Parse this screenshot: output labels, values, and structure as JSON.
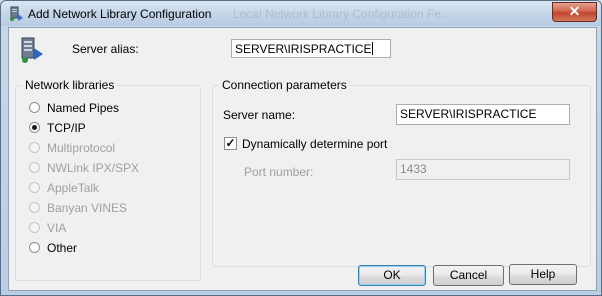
{
  "window": {
    "title": "Add Network Library Configuration",
    "title_ghost": "Local Network Library Configuration Fe...",
    "close_glyph": "✕"
  },
  "alias": {
    "label": "Server alias:",
    "mnemonic": "a",
    "value": "SERVER\\IRISPRACTICE"
  },
  "libraries": {
    "legend": "Network libraries",
    "items": [
      {
        "label": "Named Pipes",
        "mnemonic": "P",
        "selected": false,
        "enabled": true
      },
      {
        "label": "TCP/IP",
        "mnemonic": "T",
        "selected": true,
        "enabled": true
      },
      {
        "label": "Multiprotocol",
        "mnemonic": "M",
        "selected": false,
        "enabled": false
      },
      {
        "label": "NWLink IPX/SPX",
        "mnemonic": "X",
        "selected": false,
        "enabled": false
      },
      {
        "label": "AppleTalk",
        "mnemonic": "A",
        "selected": false,
        "enabled": false
      },
      {
        "label": "Banyan VINES",
        "mnemonic": "V",
        "selected": false,
        "enabled": false
      },
      {
        "label": "VIA",
        "mnemonic": "I",
        "selected": false,
        "enabled": false
      },
      {
        "label": "Other",
        "mnemonic": "O",
        "selected": false,
        "enabled": true
      }
    ]
  },
  "connection": {
    "legend": "Connection parameters",
    "server_name_label": "Server name:",
    "server_name_mnemonic": "S",
    "server_name_value": "SERVER\\IRISPRACTICE",
    "dynamic_port_label": "Dynamically determine port",
    "dynamic_port_mnemonic": "D",
    "dynamic_port_checked": true,
    "check_glyph": "✓",
    "port_label": "Port number:",
    "port_value": "1433"
  },
  "buttons": {
    "ok": "OK",
    "cancel": "Cancel",
    "help": "Help"
  }
}
